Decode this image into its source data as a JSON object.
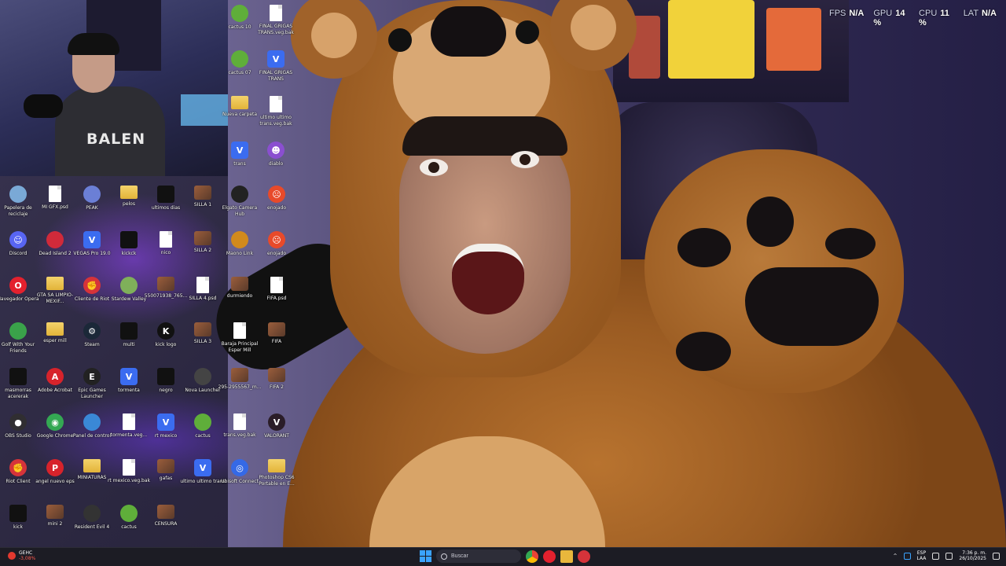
{
  "hud": {
    "fps_label": "FPS",
    "fps_value": "N/A",
    "gpu_label": "GPU",
    "gpu_value": "14 %",
    "cpu_label": "CPU",
    "cpu_value": "11 %",
    "lat_label": "LAT",
    "lat_value": "N/A"
  },
  "webcam": {
    "shirt_text": "BALEN"
  },
  "desktop_icons": [
    {
      "label": "cactus 10",
      "icon": "cactus-icon"
    },
    {
      "label": "FINAL GRIGAS TRANS.veg.bak",
      "icon": "document-icon"
    },
    {
      "label": "cactus 07",
      "icon": "cactus-icon"
    },
    {
      "label": "FINAL GRIGAS TRANS",
      "icon": "vegas-icon"
    },
    {
      "label": "Nueva carpeta",
      "icon": "folder-icon"
    },
    {
      "label": "ultimo ultimo trans.veg.bak",
      "icon": "document-icon"
    },
    {
      "label": "trans",
      "icon": "vegas-icon"
    },
    {
      "label": "diablo",
      "icon": "devil-emoji-icon"
    },
    {
      "label": "Papelera de reciclaje",
      "icon": "recycle-bin-icon"
    },
    {
      "label": "MI GFX.psd",
      "icon": "document-icon"
    },
    {
      "label": "PEAK",
      "icon": "peak-game-icon"
    },
    {
      "label": "pelos",
      "icon": "folder-icon"
    },
    {
      "label": "ultimos dias",
      "icon": "video-icon"
    },
    {
      "label": "SILLA 1",
      "icon": "image-icon"
    },
    {
      "label": "Elgato Camera Hub",
      "icon": "elgato-icon"
    },
    {
      "label": "enojado",
      "icon": "angry-emoji-icon"
    },
    {
      "label": "Discord",
      "icon": "discord-icon"
    },
    {
      "label": "Dead Island 2",
      "icon": "dead-island-icon"
    },
    {
      "label": "VEGAS Pro 19.0",
      "icon": "vegas-icon"
    },
    {
      "label": "kickck",
      "icon": "video-icon"
    },
    {
      "label": "nico",
      "icon": "document-icon"
    },
    {
      "label": "SILLA 2",
      "icon": "image-icon"
    },
    {
      "label": "Maono Link",
      "icon": "maono-icon"
    },
    {
      "label": "enojado",
      "icon": "angry-emoji-icon"
    },
    {
      "label": "Navegador Opera",
      "icon": "opera-icon"
    },
    {
      "label": "GTA SA LIMPIO-MEXIF...",
      "icon": "folder-icon"
    },
    {
      "label": "Cliente de Riot",
      "icon": "riot-icon"
    },
    {
      "label": "Stardew Valley",
      "icon": "stardew-icon"
    },
    {
      "label": "550071938_765...",
      "icon": "image-icon"
    },
    {
      "label": "SILLA 4.psd",
      "icon": "document-icon"
    },
    {
      "label": "durmiendo",
      "icon": "image-icon"
    },
    {
      "label": "FIFA.psd",
      "icon": "document-icon"
    },
    {
      "label": "Golf With Your Friends",
      "icon": "golf-icon"
    },
    {
      "label": "esper mill",
      "icon": "folder-icon"
    },
    {
      "label": "Steam",
      "icon": "steam-icon"
    },
    {
      "label": "multi",
      "icon": "video-icon"
    },
    {
      "label": "kick logo",
      "icon": "kick-icon"
    },
    {
      "label": "SILLA 3",
      "icon": "image-icon"
    },
    {
      "label": "Baraja Principal Esper Mill",
      "icon": "document-icon"
    },
    {
      "label": "FIFA",
      "icon": "image-icon"
    },
    {
      "label": "masmorras acererak",
      "icon": "video-icon"
    },
    {
      "label": "Adobe Acrobat",
      "icon": "acrobat-icon"
    },
    {
      "label": "Epic Games Launcher",
      "icon": "epic-icon"
    },
    {
      "label": "tormenta",
      "icon": "vegas-icon"
    },
    {
      "label": "negro",
      "icon": "black-image-icon"
    },
    {
      "label": "Nova Launcher",
      "icon": "nova-icon"
    },
    {
      "label": "295-2955567_m...",
      "icon": "image-icon"
    },
    {
      "label": "FIFA 2",
      "icon": "image-icon"
    },
    {
      "label": "OBS Studio",
      "icon": "obs-icon"
    },
    {
      "label": "Google Chrome",
      "icon": "chrome-icon"
    },
    {
      "label": "Panel de control",
      "icon": "control-panel-icon"
    },
    {
      "label": "tormenta.veg...",
      "icon": "document-icon"
    },
    {
      "label": "rt mexico",
      "icon": "vegas-icon"
    },
    {
      "label": "cactus",
      "icon": "cactus-icon"
    },
    {
      "label": "trans.veg.bak",
      "icon": "document-icon"
    },
    {
      "label": "VALORANT",
      "icon": "valorant-icon"
    },
    {
      "label": "Riot Client",
      "icon": "riot-icon"
    },
    {
      "label": "angel nuevo eps",
      "icon": "pdf-icon"
    },
    {
      "label": "MINIATURAS",
      "icon": "folder-icon"
    },
    {
      "label": "rt mexico.veg.bak",
      "icon": "document-icon"
    },
    {
      "label": "gafas",
      "icon": "image-icon"
    },
    {
      "label": "ultimo ultimo trans",
      "icon": "vegas-icon"
    },
    {
      "label": "Ubisoft Connect",
      "icon": "ubisoft-icon"
    },
    {
      "label": "Photoshop CS6 Portable en E...",
      "icon": "folder-icon"
    },
    {
      "label": "kick",
      "icon": "video-icon"
    },
    {
      "label": "mini 2",
      "icon": "image-icon"
    },
    {
      "label": "Resident Evil 4",
      "icon": "resident-evil-icon"
    },
    {
      "label": "cactus",
      "icon": "cactus-icon"
    },
    {
      "label": "CENSURA",
      "icon": "image-icon"
    }
  ],
  "taskbar": {
    "weather_name": "GEHC",
    "weather_value": "-3,08%",
    "search_placeholder": "Buscar",
    "lang_top": "ESP",
    "lang_bottom": "LAA",
    "time": "7:36 p. m.",
    "date": "26/10/2025"
  },
  "colors": {
    "hud_text": "#cfd3e8",
    "taskbar_bg": "#1c1c24",
    "accent_blue": "#3aa3ff",
    "stock_down": "#ff5a4e"
  }
}
